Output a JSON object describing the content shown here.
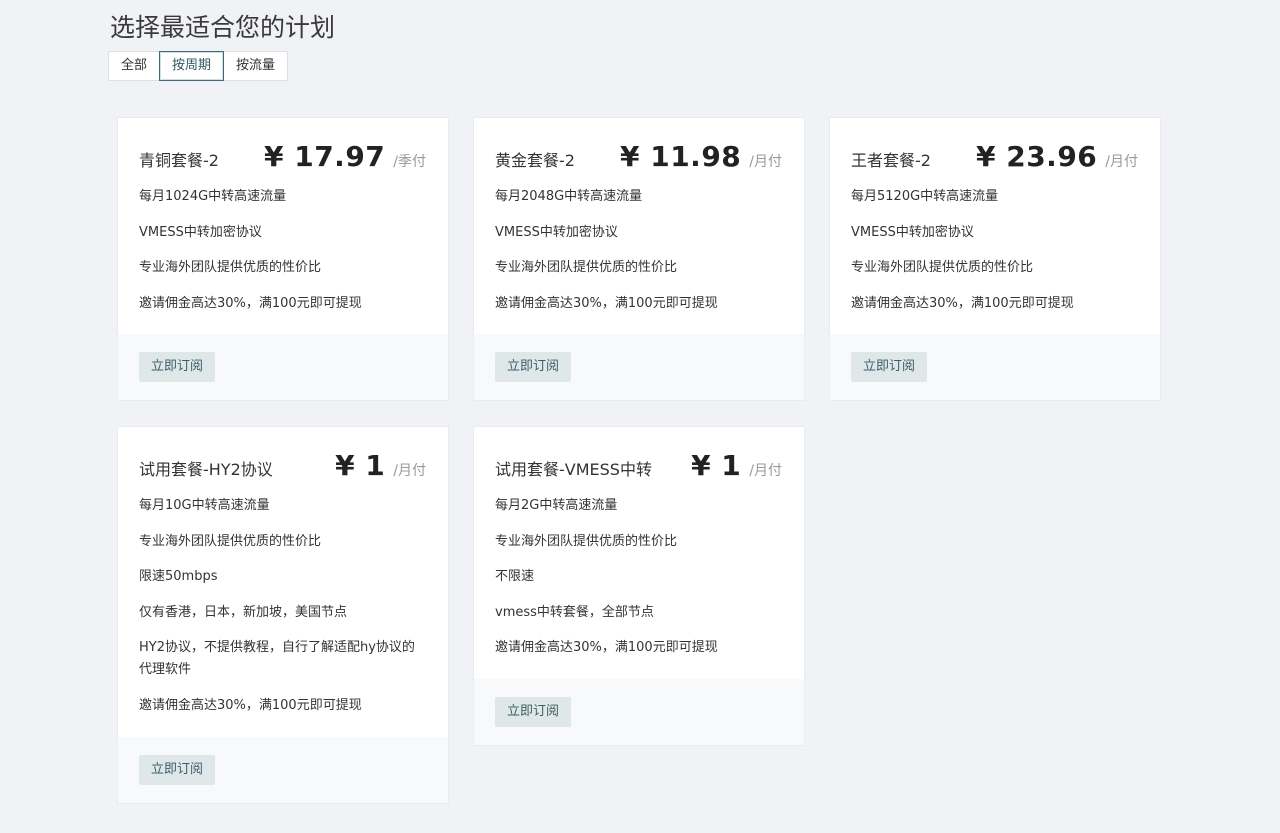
{
  "page": {
    "title": "选择最适合您的计划"
  },
  "filters": [
    {
      "label": "全部",
      "active": false
    },
    {
      "label": "按周期",
      "active": true
    },
    {
      "label": "按流量",
      "active": false
    }
  ],
  "plans": [
    {
      "name": "青铜套餐-2",
      "price": "¥ 17.97",
      "period": "/季付",
      "features": [
        "每月1024G中转高速流量",
        "VMESS中转加密协议",
        "专业海外团队提供优质的性价比",
        "邀请佣金高达30%，满100元即可提现"
      ],
      "button": "立即订阅"
    },
    {
      "name": "黄金套餐-2",
      "price": "¥ 11.98",
      "period": "/月付",
      "features": [
        "每月2048G中转高速流量",
        "VMESS中转加密协议",
        "专业海外团队提供优质的性价比",
        "邀请佣金高达30%，满100元即可提现"
      ],
      "button": "立即订阅"
    },
    {
      "name": "王者套餐-2",
      "price": "¥ 23.96",
      "period": "/月付",
      "features": [
        "每月5120G中转高速流量",
        "VMESS中转加密协议",
        "专业海外团队提供优质的性价比",
        "邀请佣金高达30%，满100元即可提现"
      ],
      "button": "立即订阅"
    },
    {
      "name": "试用套餐-HY2协议",
      "price": "¥ 1",
      "period": "/月付",
      "features": [
        "每月10G中转高速流量",
        "专业海外团队提供优质的性价比",
        "限速50mbps",
        "仅有香港，日本，新加坡，美国节点",
        "HY2协议，不提供教程，自行了解适配hy协议的代理软件",
        "邀请佣金高达30%，满100元即可提现"
      ],
      "button": "立即订阅"
    },
    {
      "name": "试用套餐-VMESS中转",
      "price": "¥ 1",
      "period": "/月付",
      "features": [
        "每月2G中转高速流量",
        "专业海外团队提供优质的性价比",
        "不限速",
        "vmess中转套餐，全部节点",
        "邀请佣金高达30%，满100元即可提现"
      ],
      "button": "立即订阅"
    }
  ]
}
